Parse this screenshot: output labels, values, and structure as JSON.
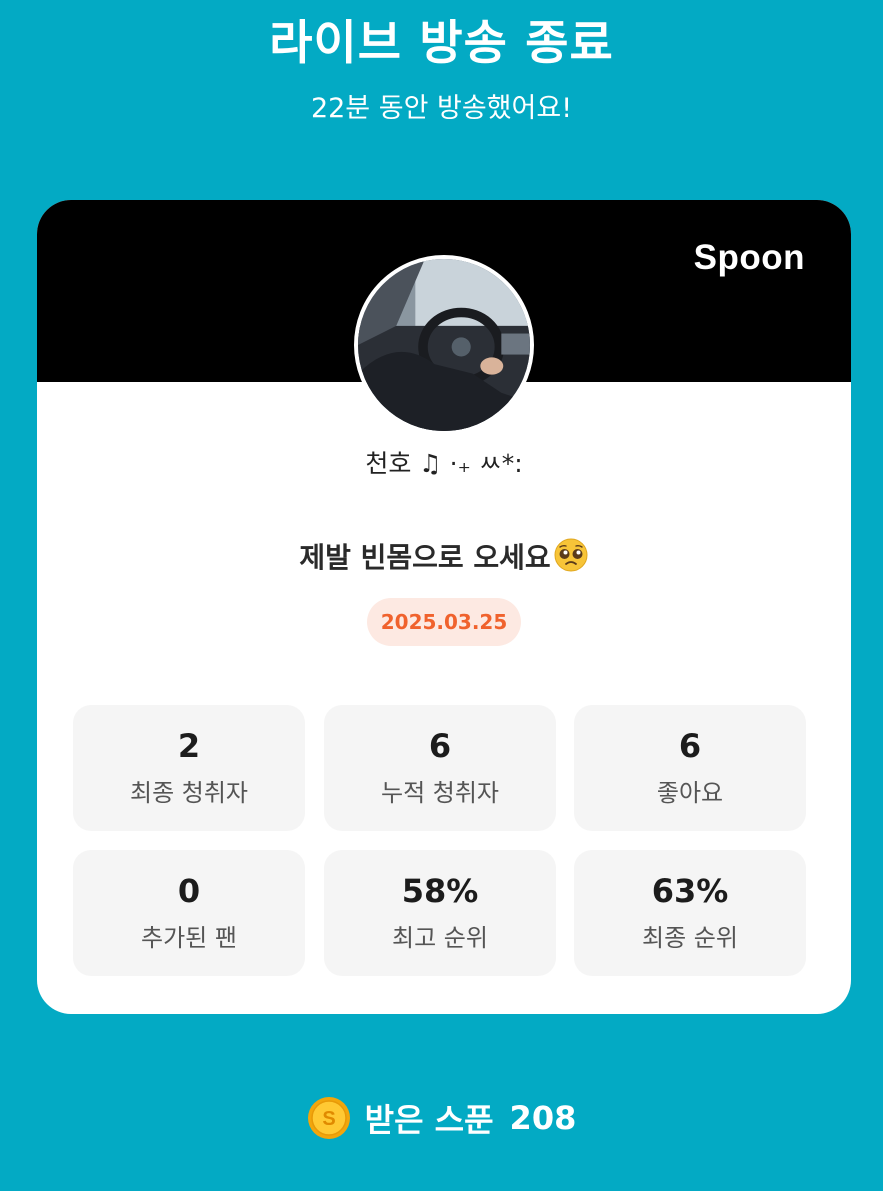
{
  "header": {
    "title": "라이브 방송 종료",
    "subtitle": "22분 동안 방송했어요!"
  },
  "card": {
    "brand": "Spoon",
    "nickname": "천호 ♫ ·₊ ㅆ*:",
    "room_title": "제발 빈몸으로 오세요",
    "room_title_emoji": "pleading-face-emoji",
    "date": "2025.03.25",
    "stats": [
      {
        "value": "2",
        "label": "최종 청취자"
      },
      {
        "value": "6",
        "label": "누적 청취자"
      },
      {
        "value": "6",
        "label": "좋아요"
      },
      {
        "value": "0",
        "label": "추가된 팬"
      },
      {
        "value": "58%",
        "label": "최고 순위"
      },
      {
        "value": "63%",
        "label": "최종 순위"
      }
    ]
  },
  "footer": {
    "spoon_icon": "gold-coin-icon",
    "spoon_label": "받은 스푼",
    "spoon_count": "208"
  },
  "colors": {
    "background": "#03aac4",
    "card_header": "#000000",
    "date_text": "#f0622d",
    "date_badge_bg": "#fde9e2",
    "stat_bg": "#f5f5f5"
  }
}
